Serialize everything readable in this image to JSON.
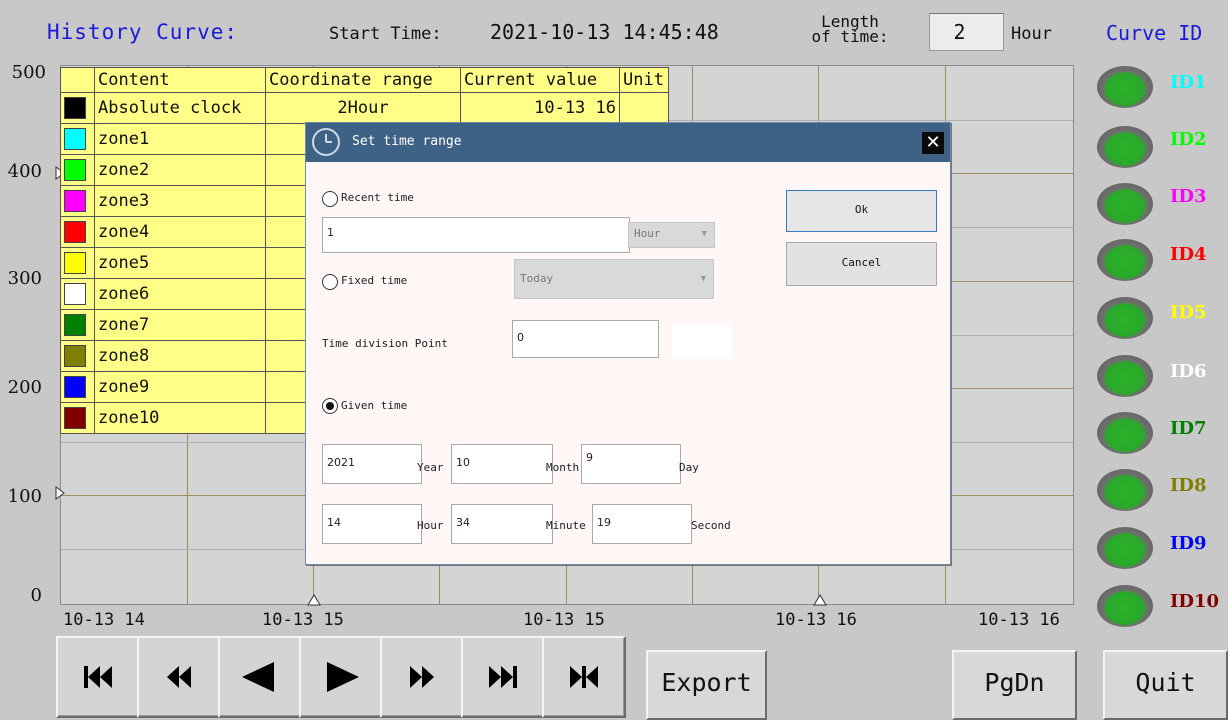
{
  "header": {
    "title": "History Curve:",
    "start_time_label": "Start Time:",
    "start_time_value": "2021-10-13 14:45:48",
    "length_label_line1": "Length",
    "length_label_line2": "of time:",
    "length_value": "2",
    "length_unit": "Hour",
    "curve_id_title": "Curve ID"
  },
  "y_axis": [
    "500",
    "400",
    "300",
    "200",
    "100",
    "0"
  ],
  "x_axis": [
    "10-13 14",
    "10-13 15",
    "10-13 15",
    "10-13 16",
    "10-13 16"
  ],
  "legend": {
    "headers": [
      "Content",
      "Coordinate range",
      "Current value",
      "Unit"
    ],
    "rows": [
      {
        "name": "Absolute clock",
        "color": "#000000",
        "range": "2Hour",
        "value": "10-13 16"
      },
      {
        "name": "zone1",
        "color": "#00ffff"
      },
      {
        "name": "zone2",
        "color": "#00ff00"
      },
      {
        "name": "zone3",
        "color": "#ff00ff"
      },
      {
        "name": "zone4",
        "color": "#ff0000"
      },
      {
        "name": "zone5",
        "color": "#ffff00"
      },
      {
        "name": "zone6",
        "color": "#ffffff"
      },
      {
        "name": "zone7",
        "color": "#008000"
      },
      {
        "name": "zone8",
        "color": "#808000"
      },
      {
        "name": "zone9",
        "color": "#0000ff"
      },
      {
        "name": "zone10",
        "color": "#800000"
      }
    ]
  },
  "dialog": {
    "title": "Set time range",
    "recent_time_label": "Recent time",
    "recent_time_value": "1",
    "recent_time_unit": "Hour",
    "fixed_time_label": "Fixed time",
    "fixed_time_option": "Today",
    "division_label": "Time division Point",
    "division_value": "0",
    "given_time_label": "Given time",
    "selected_mode": "Given time",
    "year": "2021",
    "year_label": "Year",
    "month": "10",
    "month_label": "Month",
    "day": "9",
    "day_label": "Day",
    "hour": "14",
    "hour_label": "Hour",
    "minute": "34",
    "minute_label": "Minute",
    "second": "19",
    "second_label": "Second",
    "ok_label": "Ok",
    "cancel_label": "Cancel"
  },
  "curve_ids": [
    {
      "label": "ID1",
      "color": "#00ffff"
    },
    {
      "label": "ID2",
      "color": "#00ff00"
    },
    {
      "label": "ID3",
      "color": "#ff00ff"
    },
    {
      "label": "ID4",
      "color": "#ff0000"
    },
    {
      "label": "ID5",
      "color": "#ffff00"
    },
    {
      "label": "ID6",
      "color": "#ffffff"
    },
    {
      "label": "ID7",
      "color": "#008000"
    },
    {
      "label": "ID8",
      "color": "#808000"
    },
    {
      "label": "ID9",
      "color": "#0000ff"
    },
    {
      "label": "ID10",
      "color": "#800000"
    }
  ],
  "nav_buttons": [
    "first-icon",
    "fast-rewind-icon",
    "previous-icon",
    "next-icon",
    "fast-forward-icon",
    "last-icon",
    "jump-icon"
  ],
  "buttons": {
    "export": "Export",
    "pgdn": "PgDn",
    "quit": "Quit"
  }
}
